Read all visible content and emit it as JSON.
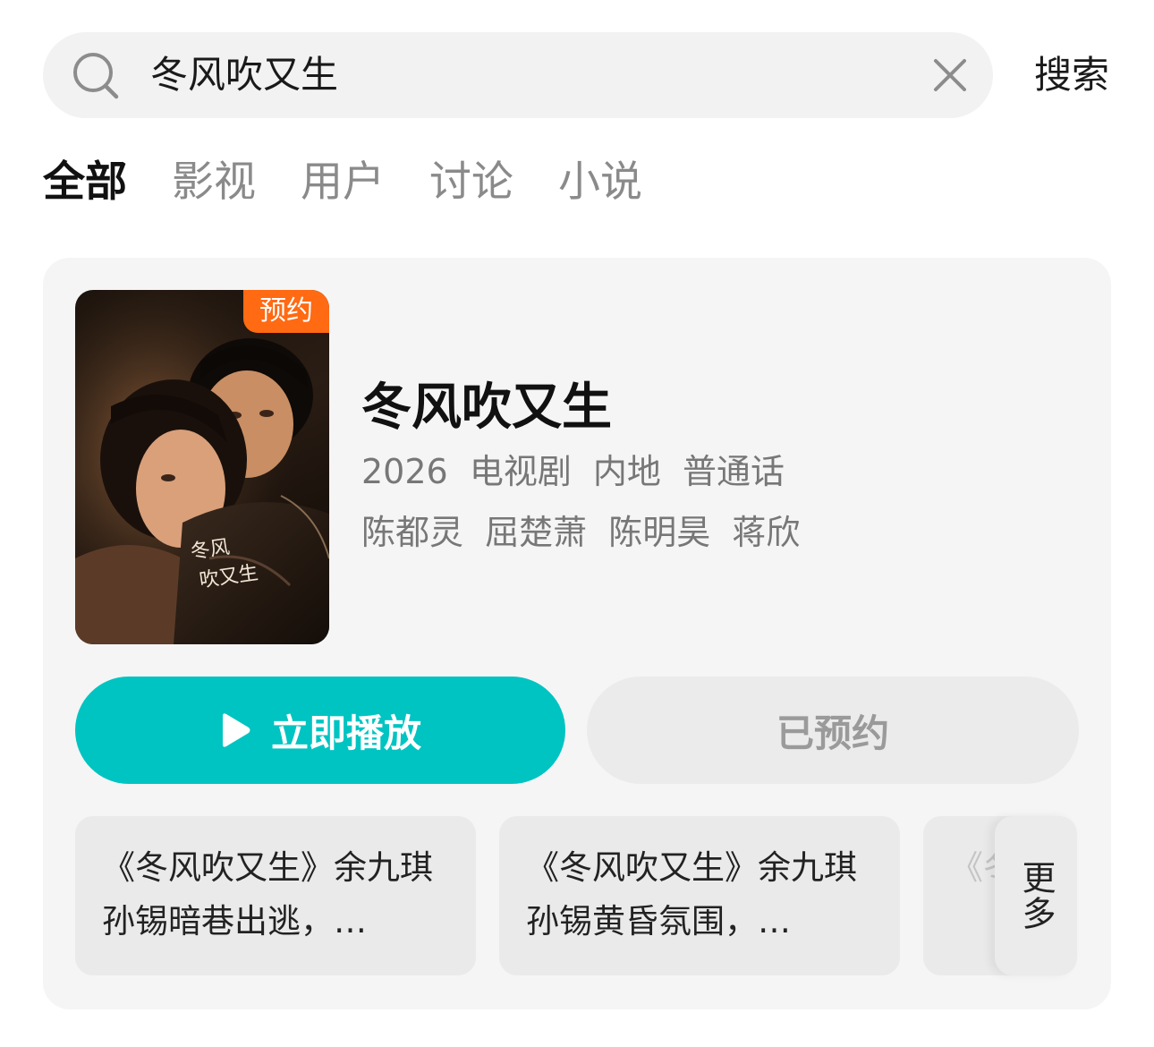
{
  "search": {
    "query": "冬风吹又生",
    "button_label": "搜索"
  },
  "tabs": [
    {
      "label": "全部",
      "active": true
    },
    {
      "label": "影视",
      "active": false
    },
    {
      "label": "用户",
      "active": false
    },
    {
      "label": "讨论",
      "active": false
    },
    {
      "label": "小说",
      "active": false
    }
  ],
  "result": {
    "badge": "预约",
    "poster_caption": "冬风吹又生",
    "title": "冬风吹又生",
    "meta": [
      "2026",
      "电视剧",
      "内地",
      "普通话"
    ],
    "cast": [
      "陈都灵",
      "屈楚萧",
      "陈明昊",
      "蒋欣"
    ],
    "play_label": "立即播放",
    "reserved_label": "已预约"
  },
  "clips": [
    {
      "text": "《冬风吹又生》余九琪孙锡暗巷出逃，…"
    },
    {
      "text": "《冬风吹又生》余九琪孙锡黄昏氛围，…"
    },
    {
      "text": "《冬风吹又生》恋…"
    }
  ],
  "more_label": "更多",
  "colors": {
    "accent": "#00c4c2",
    "badge": "#ff6a13",
    "card_bg": "#f5f5f5"
  }
}
